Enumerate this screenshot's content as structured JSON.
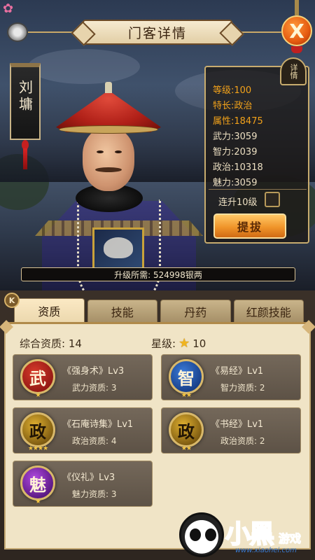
{
  "header": {
    "title": "门客详情",
    "detail_tag": "详情",
    "close_label": "X"
  },
  "character": {
    "name": "刘墉"
  },
  "stats": {
    "level_label": "等级:",
    "level_value": "100",
    "specialty_label": "特长:",
    "specialty_value": "政治",
    "attribute_label": "属性:",
    "attribute_value": "18475",
    "force_label": "武力:",
    "force_value": "3059",
    "intellect_label": "智力:",
    "intellect_value": "2039",
    "politics_label": "政治:",
    "politics_value": "10318",
    "charm_label": "魅力:",
    "charm_value": "3059"
  },
  "actions": {
    "upgrade10_label": "连升10级",
    "upgrade10_checked": false,
    "promote_label": "提拔"
  },
  "upgrade_cost": "升级所需: 524998银两",
  "tabs": [
    {
      "label": "资质",
      "active": true
    },
    {
      "label": "技能",
      "active": false
    },
    {
      "label": "丹药",
      "active": false
    },
    {
      "label": "红颜技能",
      "active": false
    }
  ],
  "qualification": {
    "summary_label": "综合资质: 14",
    "star_label": "星级:",
    "star_value": "10"
  },
  "skills": [
    {
      "badge": "武",
      "stars": "★",
      "name": "《强身术》Lv3",
      "sub": "武力资质: 3",
      "color": "#a31818"
    },
    {
      "badge": "智",
      "stars": "★★",
      "name": "《易经》Lv1",
      "sub": "智力资质: 2",
      "color": "#1a4ea0"
    },
    {
      "badge": "政",
      "stars": "★★★★",
      "name": "《石庵诗集》Lv1",
      "sub": "政治资质: 4",
      "color": "#8a6a10"
    },
    {
      "badge": "政",
      "stars": "★★",
      "name": "《书经》Lv1",
      "sub": "政治资质: 2",
      "color": "#8a6a10"
    },
    {
      "badge": "魅",
      "stars": "★",
      "name": "《仪礼》Lv3",
      "sub": "魅力资质: 3",
      "color": "#7a1ea8"
    }
  ],
  "watermark": {
    "text": "小黑",
    "text2": "游戏",
    "url": "www.xiaohei.com"
  },
  "colors": {
    "accent": "#f2a21a",
    "button": "#f0952a",
    "panel_bg": "#f0e4c6"
  }
}
